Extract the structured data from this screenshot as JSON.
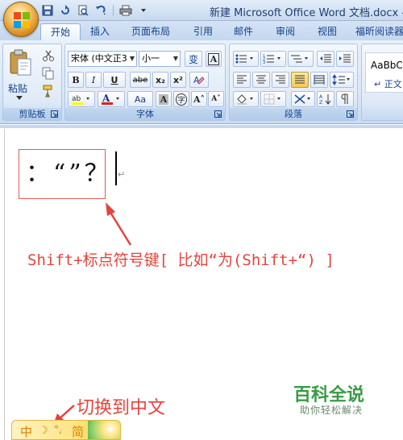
{
  "window": {
    "title": "新建 Microsoft Office Word 文档.docx - M"
  },
  "ribbon": {
    "tabs": [
      "开始",
      "插入",
      "页面布局",
      "引用",
      "邮件",
      "审阅",
      "视图",
      "福昕阅读器"
    ],
    "active_tab": "开始",
    "clipboard": {
      "paste_label": "粘贴",
      "group_label": "剪贴板"
    },
    "font": {
      "font_name": "宋体 (中文正3",
      "font_size": "小一",
      "group_label": "字体",
      "buttons": [
        "B",
        "I",
        "U",
        "abe",
        "x₂",
        "x²",
        "Aa",
        "A",
        "A",
        "A",
        "字",
        "A˄",
        "A˅"
      ],
      "wen_label": "变",
      "wen_label2": "A"
    },
    "paragraph": {
      "group_label": "段落"
    },
    "styles": {
      "preview_text": "AaBbCc",
      "style_name": "↵ 正文"
    }
  },
  "document": {
    "typed_text": "：“”？",
    "paragraph_mark": "↵"
  },
  "annotations": {
    "main_note": "Shift+标点符号键[ 比如“为(Shift+“) ]",
    "ime_note": "切换到中文"
  },
  "watermark": {
    "title": "百科全说",
    "subtitle": "助你轻松解决"
  },
  "ime_bar": {
    "items": [
      "中",
      "☽",
      "°,",
      "简"
    ]
  },
  "colors": {
    "accent_red": "#e5443c",
    "watermark_green": "#3a9a45",
    "ribbon_blue": "#15428b"
  }
}
